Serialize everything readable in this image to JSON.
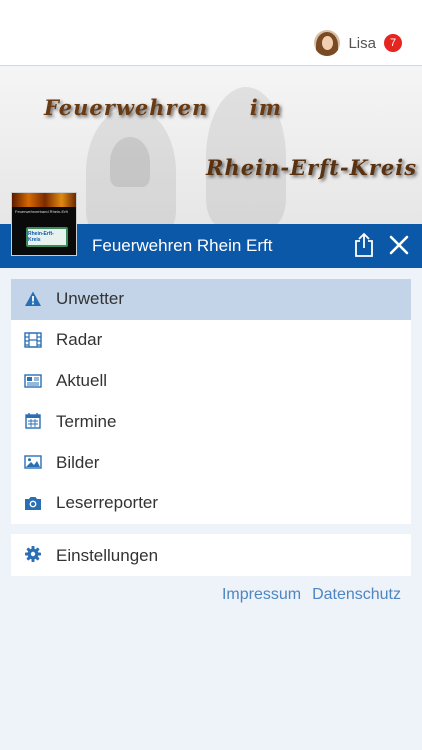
{
  "user": {
    "name": "Lisa",
    "badge_count": "7"
  },
  "banner": {
    "line1": "Feuerwehren     im",
    "line2": "Rhein-Erft-Kreis"
  },
  "logo": {
    "small_text": "Feuerwehrverband Rhein-Erft",
    "plate_text": "Rhein-Erft-Kreis"
  },
  "header": {
    "title": "Feuerwehren Rhein Erft",
    "share_icon": "share-icon",
    "close_icon": "close-icon"
  },
  "menu": {
    "items": [
      {
        "label": "Unwetter",
        "icon": "warning-icon",
        "active": true
      },
      {
        "label": "Radar",
        "icon": "film-icon",
        "active": false
      },
      {
        "label": "Aktuell",
        "icon": "newspaper-icon",
        "active": false
      },
      {
        "label": "Termine",
        "icon": "calendar-icon",
        "active": false
      },
      {
        "label": "Bilder",
        "icon": "image-icon",
        "active": false
      },
      {
        "label": "Leserreporter",
        "icon": "camera-icon",
        "active": false
      }
    ],
    "settings": {
      "label": "Einstellungen",
      "icon": "gear-icon"
    }
  },
  "footer": {
    "impressum": "Impressum",
    "datenschutz": "Datenschutz"
  },
  "colors": {
    "primary": "#0c58a8",
    "active_row": "#c3d3e8",
    "icon": "#2a6fb5",
    "link": "#4d86c0",
    "badge": "#e52520"
  }
}
